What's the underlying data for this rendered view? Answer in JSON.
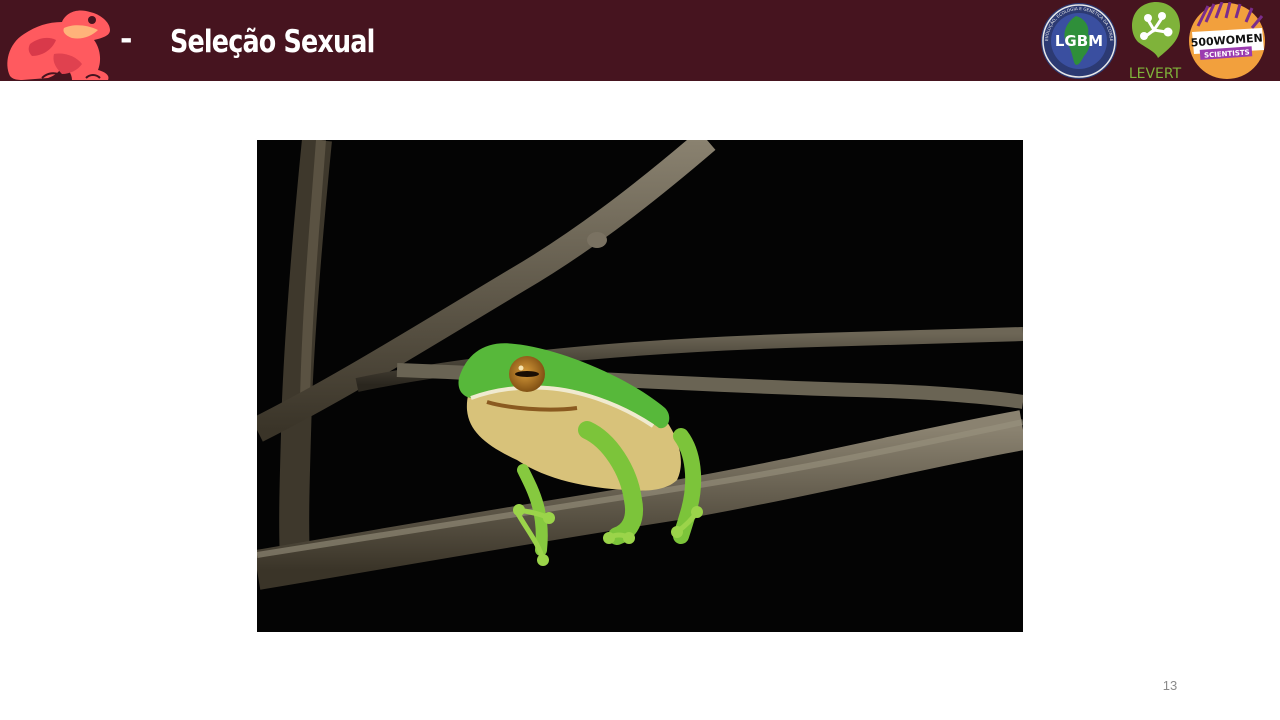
{
  "header": {
    "separator": "-",
    "title": "Seleção Sexual",
    "background_color": "#46141f",
    "logo_icon": "frog-icon",
    "partners": {
      "lgbm": "LGBM",
      "lgbm_ring_text": "EVOLUÇÃO, ECOLOGIA E GENÉTICA DA CONSERVAÇÃO",
      "levert": "LEVERT",
      "sw_line1": "500WOMEN",
      "sw_line2": "SCIENTISTS"
    }
  },
  "slide": {
    "image_subject": "green tree frog on branch",
    "page_number": "13"
  }
}
